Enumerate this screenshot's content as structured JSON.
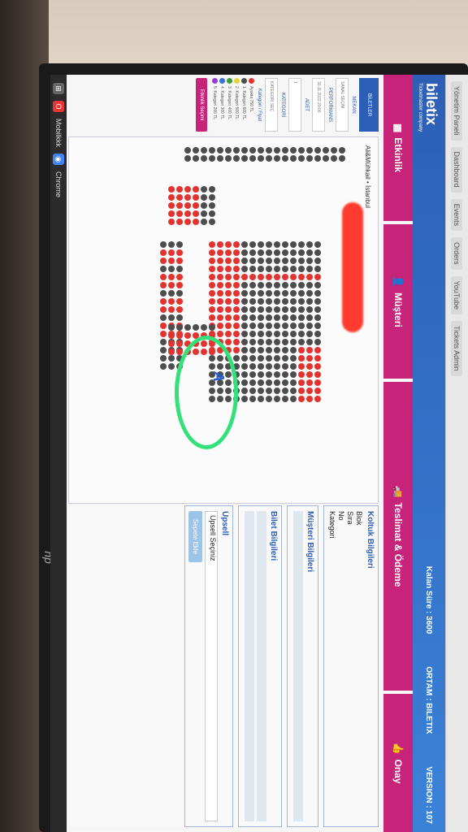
{
  "browser": {
    "bookmarks": [
      "Yönetim Paneli",
      "Dashboard",
      "Events",
      "Orders",
      "YouTube",
      "Tickets Admin"
    ]
  },
  "taskbar": {
    "items": [
      "Mobilkkk",
      "Chrome"
    ]
  },
  "header": {
    "logo": "biletix",
    "logo_sub": "Ticketmaster company",
    "kalan_sure": "Kalan Süre : 3600",
    "ortam": "ORTAM : BILETIX",
    "version": "VERSION : 107"
  },
  "steps": [
    {
      "label": "Etkinlik"
    },
    {
      "label": "Müşteri"
    },
    {
      "label": "Teslimat & Ödeme"
    },
    {
      "label": "Onay"
    }
  ],
  "filters": {
    "head": "BİLETLER",
    "label1": "MEKAN",
    "select1": "SANAL SEÇİM",
    "label2": "PERFORMANS",
    "select2": "30.11.2022 20:00",
    "label3": "ADET",
    "select3": "1",
    "label4": "KATEGORİ",
    "select4": "KATEGORİ SEÇ",
    "legend_title": "Kategori / Fiyat",
    "legend": [
      {
        "label": "Ayakta 750 TL",
        "color": "#e5322f"
      },
      {
        "label": "1. Kategori 600 TL",
        "color": "#4d4d4d"
      },
      {
        "label": "2. Kategori 500 TL",
        "color": "#e8d43a"
      },
      {
        "label": "3. Kategori 400 TL",
        "color": "#3a9e3a"
      },
      {
        "label": "4. Kategori 300 TL",
        "color": "#3a6ed8"
      },
      {
        "label": "5. Kategori 200 TL",
        "color": "#9a3ad8"
      }
    ],
    "button": "Etkinlik Seçimi"
  },
  "map": {
    "venue": "Ali&Mühkail • İstanbul",
    "mark_letter": "A"
  },
  "info": {
    "koltuk_title": "Koltuk Bilgileri",
    "koltuk_fields": [
      "Blok",
      "Sıra",
      "No",
      "Kategori"
    ],
    "musteri_title": "Müşteri Bilgileri",
    "bilet_title": "Bilet Bilgileri",
    "upsell_title": "Upsell",
    "upsell_select": "Upsell Seçiniz",
    "upsell_button": "Sepete Ekle"
  },
  "colors": {
    "accent": "#c8237a",
    "brand_blue": "#2d5fb6",
    "seat_sold": "#4d4d4d",
    "seat_available": "#e5322f",
    "marker_green": "#33e079"
  }
}
